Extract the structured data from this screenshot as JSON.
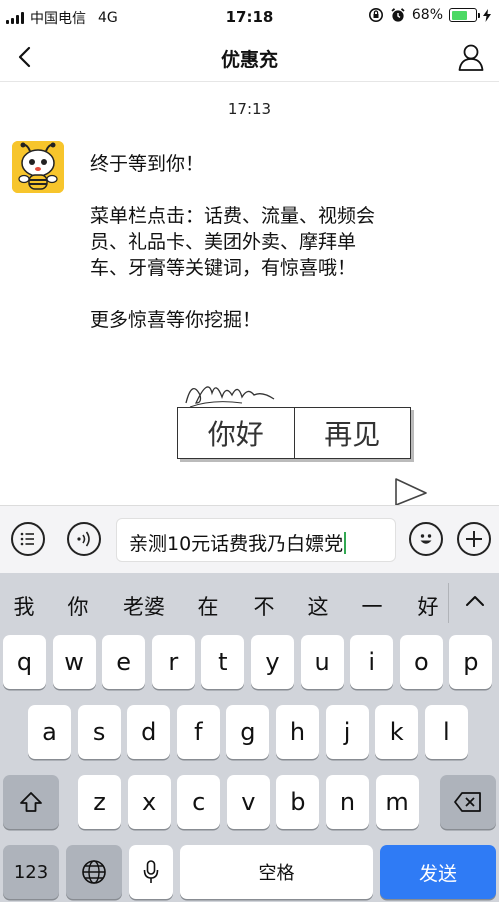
{
  "status_bar": {
    "carrier": "中国电信",
    "network": "4G",
    "time": "17:18",
    "battery_percent": "68%",
    "battery_level": 0.68,
    "battery_color": "#4cd964"
  },
  "nav": {
    "title": "优惠充",
    "back_icon": "chevron-left-icon",
    "profile_icon": "person-icon"
  },
  "chat": {
    "timestamp": "17:13",
    "avatar_icon": "bee-mascot-avatar",
    "message_lines": {
      "greeting": "终于等到你！",
      "menu_line1": "菜单栏点击：话费、流量、视频会",
      "menu_line2": "员、礼品卡、美团外卖、摩拜单",
      "menu_line3": "车、牙膏等关键词，有惊喜哦！",
      "more": "更多惊喜等你挖掘！"
    },
    "sticker": {
      "left_text": "你好",
      "right_text": "再见"
    }
  },
  "input_bar": {
    "menu_icon": "list-menu-icon",
    "voice_icon": "voice-icon",
    "text": "亲测10元话费我乃白嫖党",
    "emoji_icon": "emoji-icon",
    "add_icon": "plus-icon"
  },
  "keyboard": {
    "candidates": [
      "我",
      "你",
      "老婆",
      "在",
      "不",
      "这",
      "一",
      "好"
    ],
    "expand_icon": "chevron-up-icon",
    "row1": [
      "q",
      "w",
      "e",
      "r",
      "t",
      "y",
      "u",
      "i",
      "o",
      "p"
    ],
    "row2": [
      "a",
      "s",
      "d",
      "f",
      "g",
      "h",
      "j",
      "k",
      "l"
    ],
    "row3": [
      "z",
      "x",
      "c",
      "v",
      "b",
      "n",
      "m"
    ],
    "shift_icon": "shift-icon",
    "backspace_icon": "backspace-icon",
    "numbers_label": "123",
    "globe_icon": "globe-icon",
    "mic_icon": "microphone-icon",
    "space_label": "空格",
    "send_label": "发送",
    "send_color": "#2f7bf5"
  }
}
